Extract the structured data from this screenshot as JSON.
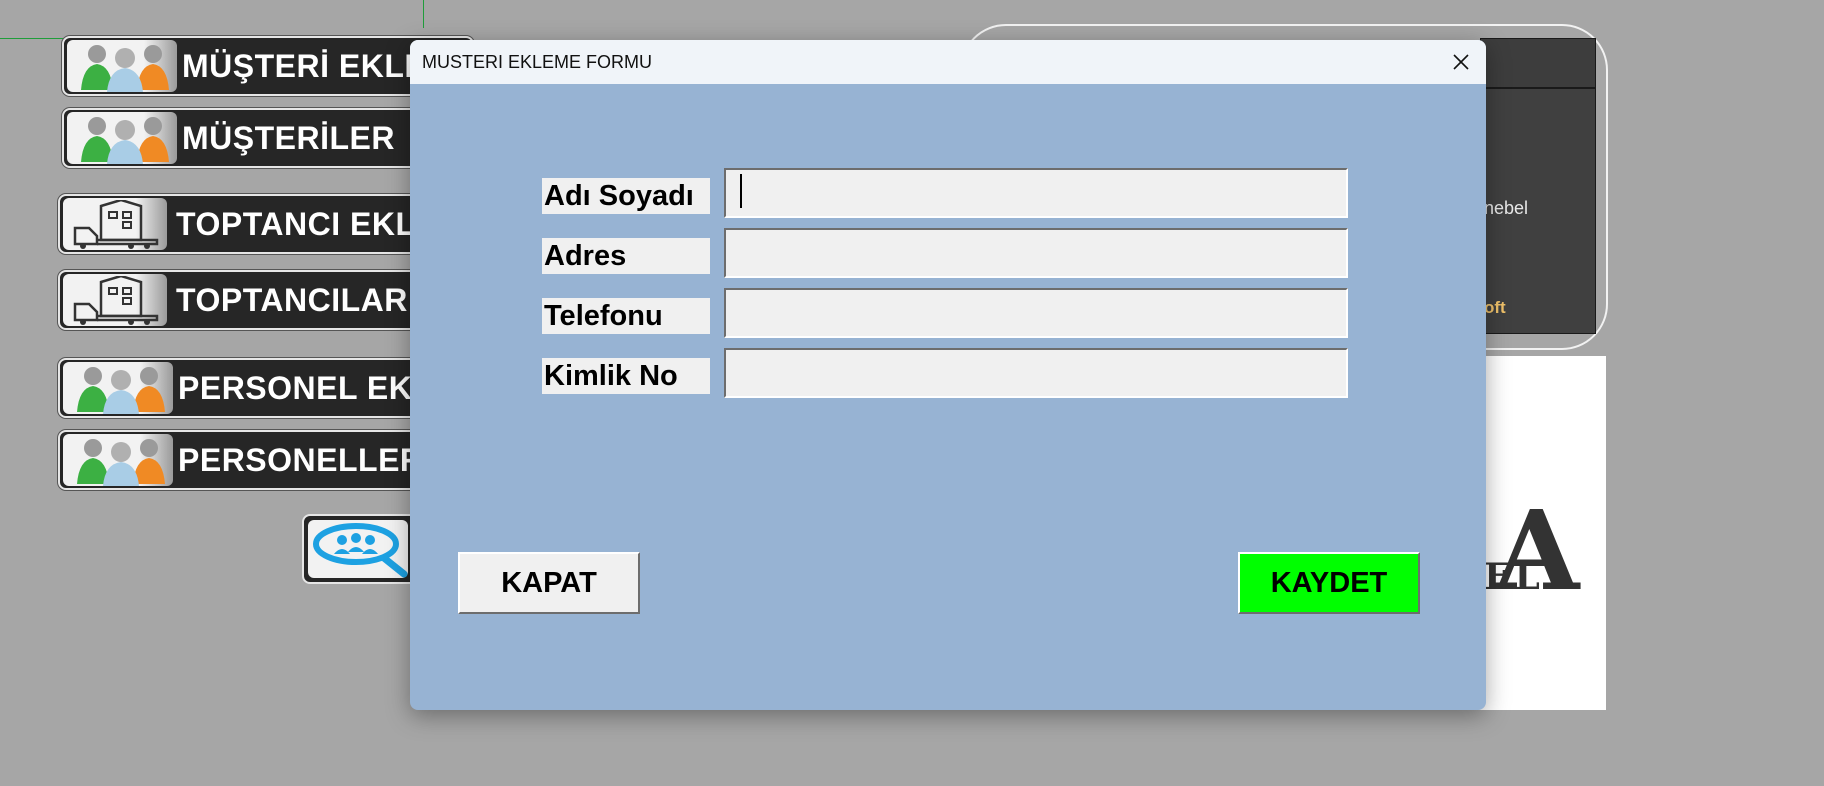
{
  "dialog": {
    "title": "MUSTERI EKLEME FORMU",
    "fields": [
      {
        "label": "Adı Soyadı",
        "value": ""
      },
      {
        "label": "Adres",
        "value": ""
      },
      {
        "label": "Telefonu",
        "value": ""
      },
      {
        "label": "Kimlik No",
        "value": ""
      }
    ],
    "close_label": "KAPAT",
    "save_label": "KAYDET"
  },
  "menu": {
    "items": [
      {
        "label": "MÜŞTERİ EKLE"
      },
      {
        "label": "MÜŞTERİLER"
      },
      {
        "label": "TOPTANCI EKLE"
      },
      {
        "label": "TOPTANCILAR"
      },
      {
        "label": "PERSONEL EKLE"
      },
      {
        "label": "PERSONELLER"
      }
    ]
  },
  "background_panel": {
    "text_fragment": "nebel",
    "soft_fragment": "oft"
  },
  "logo": {
    "letter": "A",
    "sub": "EL"
  },
  "colors": {
    "dialog_bg": "#97b3d3",
    "save_button": "#00ff00",
    "menu_bg": "#262626"
  }
}
